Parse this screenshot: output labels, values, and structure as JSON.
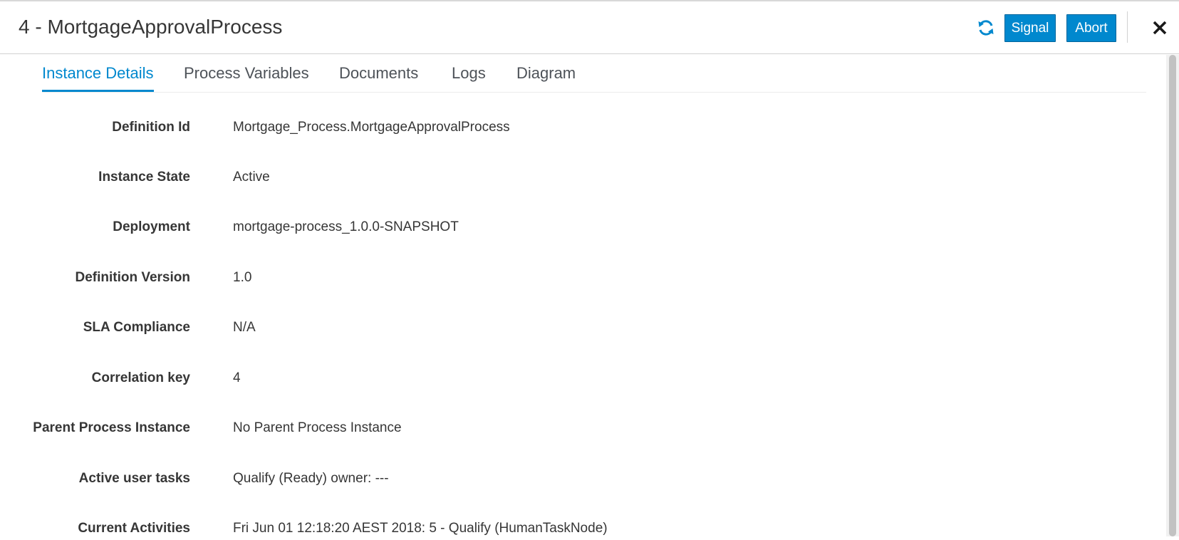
{
  "header": {
    "title": "4 - MortgageApprovalProcess",
    "refresh_icon": "refresh-icon",
    "signal_label": "Signal",
    "abort_label": "Abort",
    "close_icon": "close-icon"
  },
  "tabs": [
    {
      "label": "Instance Details",
      "active": true
    },
    {
      "label": "Process Variables",
      "active": false
    },
    {
      "label": "Documents",
      "active": false
    },
    {
      "label": "Logs",
      "active": false
    },
    {
      "label": "Diagram",
      "active": false
    }
  ],
  "details": [
    {
      "label": "Definition Id",
      "value": "Mortgage_Process.MortgageApprovalProcess"
    },
    {
      "label": "Instance State",
      "value": "Active"
    },
    {
      "label": "Deployment",
      "value": "mortgage-process_1.0.0-SNAPSHOT"
    },
    {
      "label": "Definition Version",
      "value": "1.0"
    },
    {
      "label": "SLA Compliance",
      "value": "N/A"
    },
    {
      "label": "Correlation key",
      "value": "4"
    },
    {
      "label": "Parent Process Instance",
      "value": "No Parent Process Instance"
    },
    {
      "label": "Active user tasks",
      "value": "Qualify (Ready) owner: ---"
    },
    {
      "label": "Current Activities",
      "value": "Fri Jun 01 12:18:20 AEST 2018: 5 - Qualify (HumanTaskNode)"
    }
  ],
  "colors": {
    "accent": "#0088ce",
    "text": "#363636"
  }
}
